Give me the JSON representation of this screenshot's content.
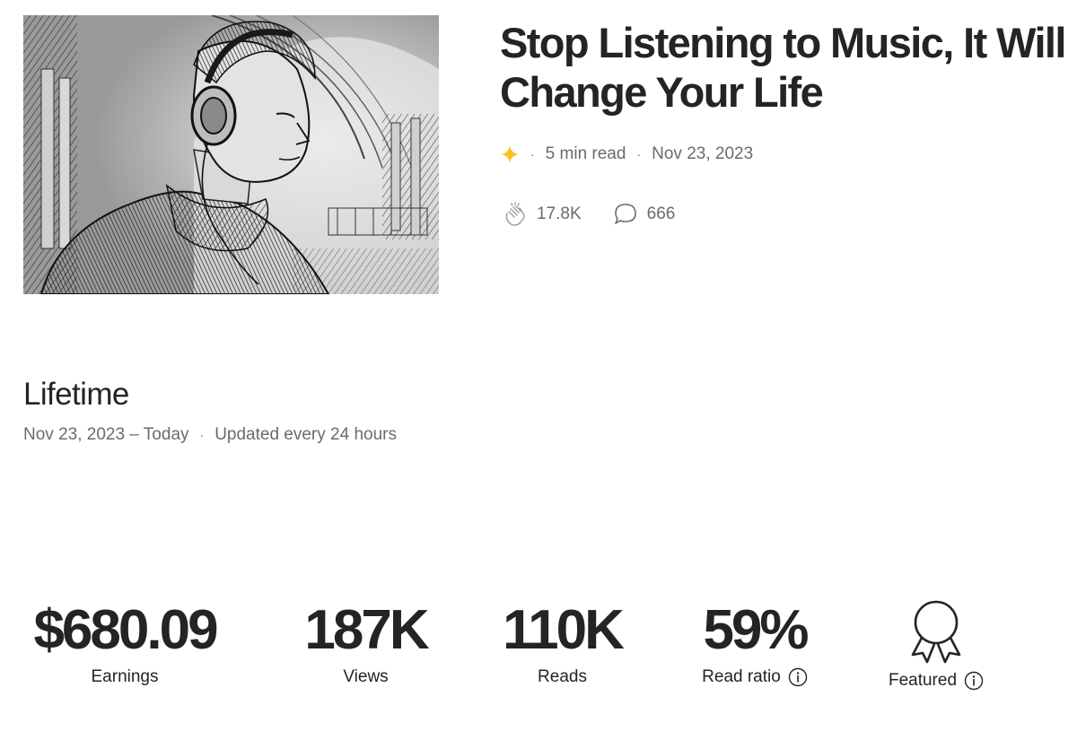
{
  "story": {
    "title_line1": "Stop Listening to Music, It Will",
    "title_line2": "Change Your Life",
    "member_icon": "star-icon",
    "read_time": "5 min read",
    "date": "Nov 23, 2023",
    "claps": "17.8K",
    "responses": "666",
    "image_icon": "illustration-man-headphones"
  },
  "lifetime": {
    "heading": "Lifetime",
    "range": "Nov 23, 2023 – Today",
    "update_note": "Updated every 24 hours"
  },
  "stats": {
    "earnings_value": "$680.09",
    "earnings_label": "Earnings",
    "views_value": "187K",
    "views_label": "Views",
    "reads_value": "110K",
    "reads_label": "Reads",
    "ratio_value": "59%",
    "ratio_label": "Read ratio",
    "featured_label": "Featured"
  },
  "colors": {
    "text_primary": "#242424",
    "text_secondary": "#6b6b6b",
    "member_star": "#ffc017"
  }
}
